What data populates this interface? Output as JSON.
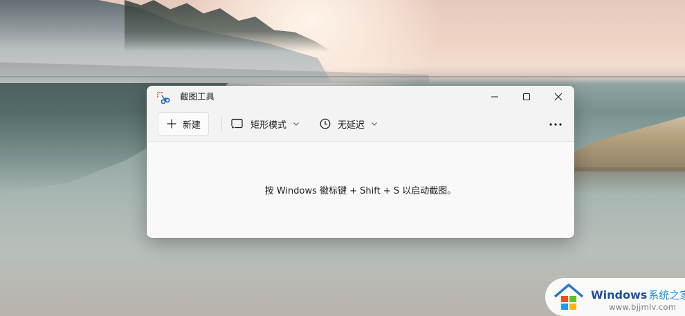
{
  "window": {
    "title": "截图工具",
    "controls": {
      "minimize_icon": "minimize-icon",
      "maximize_icon": "maximize-icon",
      "close_icon": "close-icon"
    }
  },
  "toolbar": {
    "new_label": "新建",
    "mode_label": "矩形模式",
    "delay_label": "无延迟",
    "more_icon": "more-icon"
  },
  "content": {
    "hint": "按 Windows 徽标键 + Shift + S 以启动截图。"
  },
  "watermark": {
    "brand": "Windows",
    "brand_cn": "系统之家",
    "url": "www.bjjmlv.com"
  },
  "colors": {
    "window_bg": "#f9f9f9",
    "titlebar_bg": "#f3f3f3",
    "accent_orange": "#e8734a",
    "watermark_blue": "#1b4f9c"
  }
}
